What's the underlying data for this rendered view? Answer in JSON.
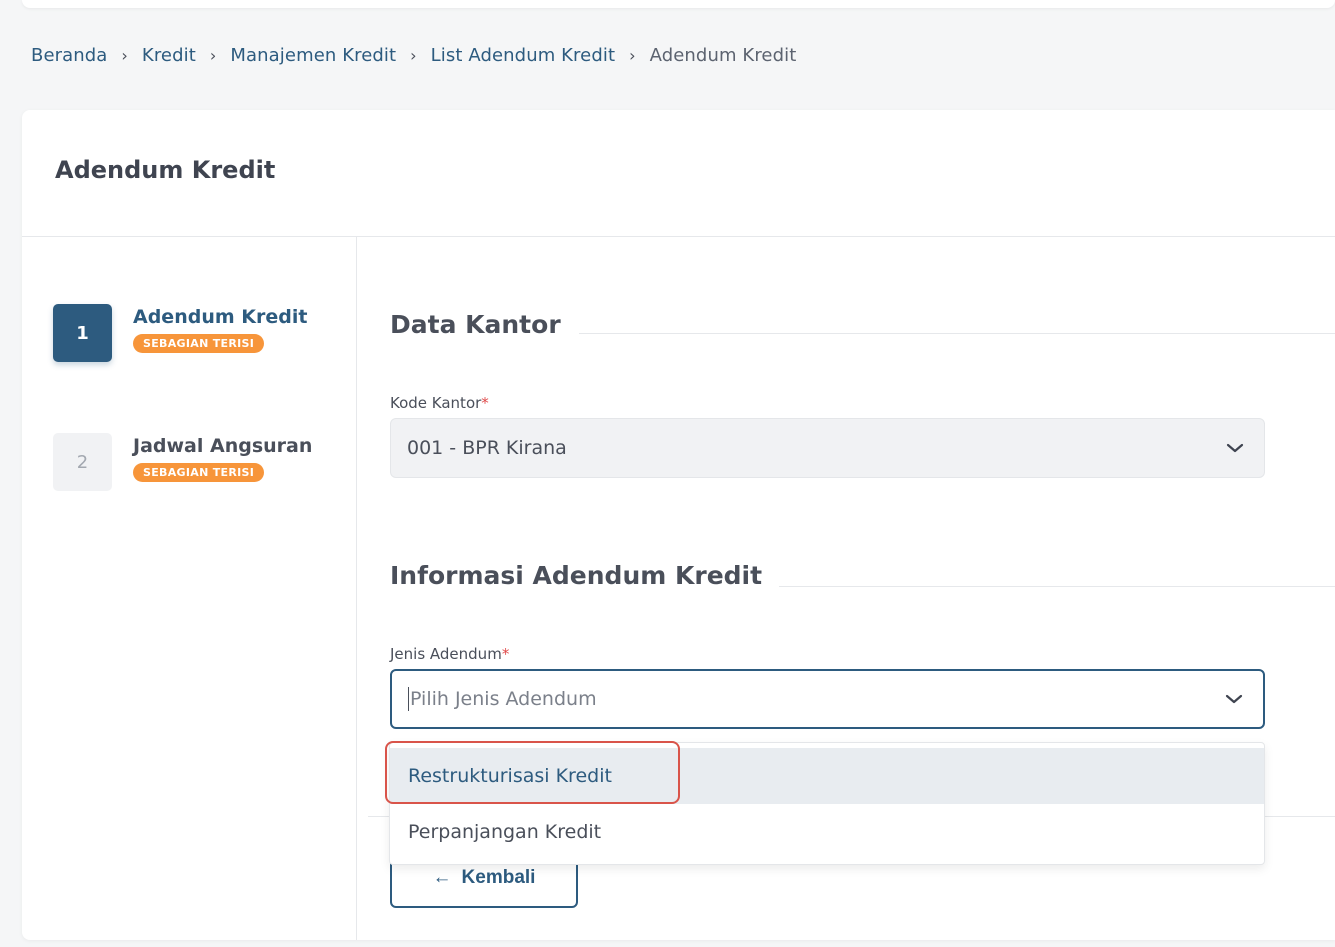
{
  "breadcrumb": {
    "items": [
      "Beranda",
      "Kredit",
      "Manajemen Kredit",
      "List Adendum Kredit"
    ],
    "current": "Adendum Kredit",
    "separator": "›"
  },
  "card": {
    "title": "Adendum Kredit"
  },
  "steps": [
    {
      "number": "1",
      "label": "Adendum Kredit",
      "badge": "SEBAGIAN TERISI",
      "state": "active"
    },
    {
      "number": "2",
      "label": "Jadwal Angsuran",
      "badge": "SEBAGIAN TERISI",
      "state": "inactive"
    }
  ],
  "sections": {
    "kantor": {
      "title": "Data Kantor",
      "field_label": "Kode Kantor",
      "required_mark": "*",
      "value": "001 - BPR Kirana"
    },
    "adendum": {
      "title": "Informasi Adendum Kredit",
      "field_label": "Jenis Adendum",
      "required_mark": "*",
      "placeholder": "Pilih Jenis Adendum",
      "options": [
        "Restrukturisasi Kredit",
        "Perpanjangan Kredit"
      ]
    }
  },
  "actions": {
    "back_label": "Kembali",
    "back_icon": "arrow-left-icon"
  },
  "colors": {
    "primary": "#2d5b7f",
    "badge": "#f7953a",
    "required": "#e04a4a",
    "highlight": "#d9544a"
  }
}
